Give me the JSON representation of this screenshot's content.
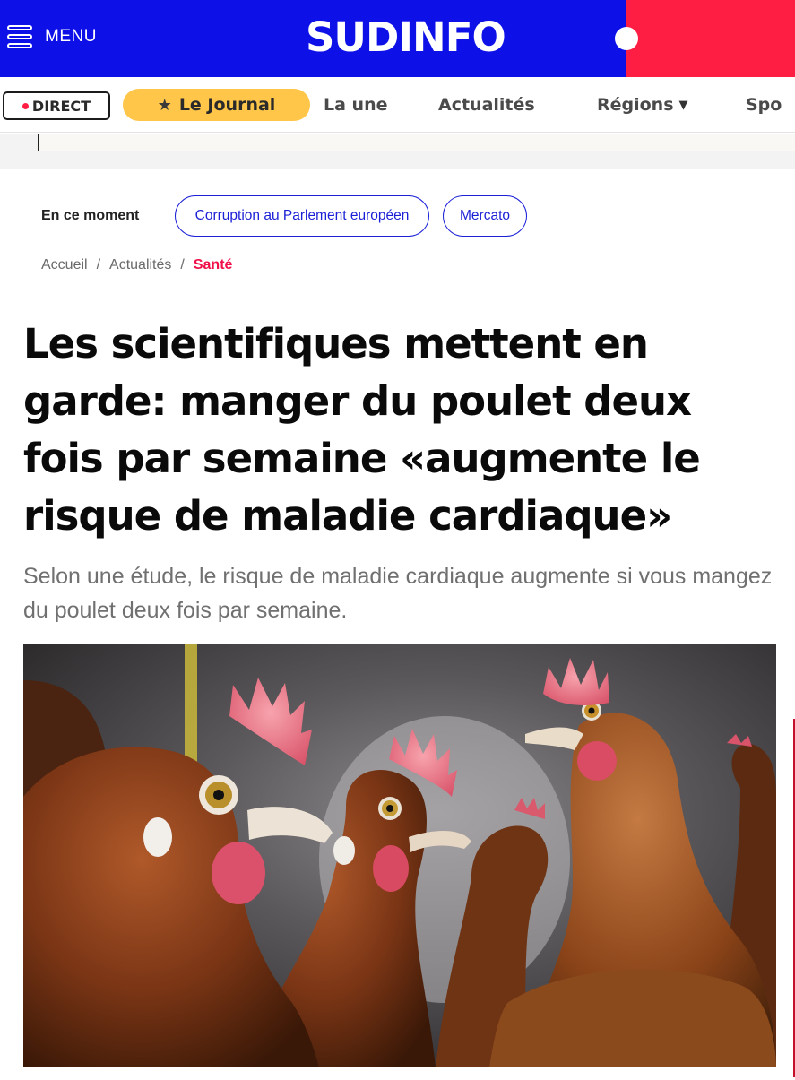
{
  "header": {
    "menu_label": "MENU",
    "logo_text": "SUDINFO",
    "brand_blue": "#0d11e8",
    "brand_red": "#ff1e43"
  },
  "nav": {
    "direct_label": "DIRECT",
    "journal_label": "Le Journal",
    "links": [
      "La une",
      "Actualités",
      "Régions",
      "Spo"
    ]
  },
  "trending": {
    "label": "En ce moment",
    "pills": [
      "Corruption au Parlement européen",
      "Mercato"
    ]
  },
  "breadcrumb": {
    "items": [
      "Accueil",
      "Actualités",
      "Santé"
    ],
    "separator": "/"
  },
  "article": {
    "title": "Les scientifiques mettent en garde: manger du poulet deux fois par semaine «augmente le risque de maladie cardiaque»",
    "lead": "Selon une étude, le risque de maladie cardiaque augmente si vous mangez du poulet deux fois par semaine."
  }
}
